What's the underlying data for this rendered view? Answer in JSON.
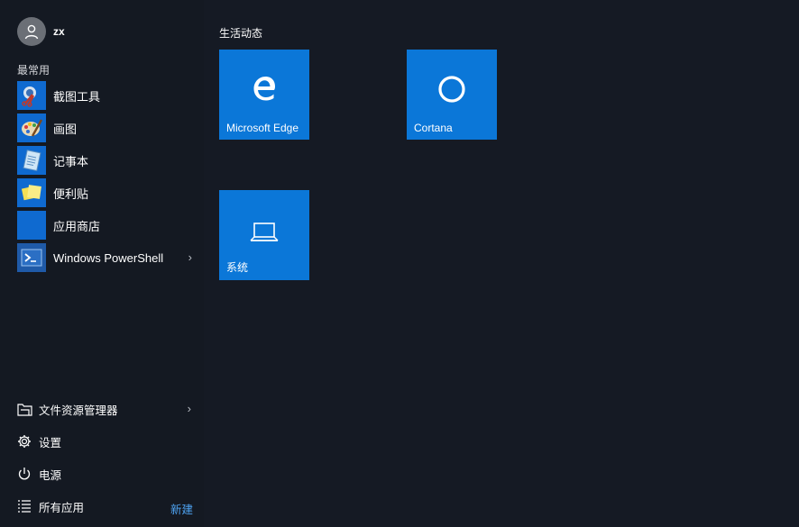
{
  "user": {
    "name": "zx"
  },
  "most_used": {
    "label": "最常用",
    "items": [
      {
        "label": "截图工具",
        "icon": "snipping-tool-icon",
        "has_submenu": false
      },
      {
        "label": "画图",
        "icon": "paint-icon",
        "has_submenu": false
      },
      {
        "label": "记事本",
        "icon": "notepad-icon",
        "has_submenu": false
      },
      {
        "label": "便利贴",
        "icon": "sticky-notes-icon",
        "has_submenu": false
      },
      {
        "label": "应用商店",
        "icon": "store-icon",
        "has_submenu": false
      },
      {
        "label": "Windows PowerShell",
        "icon": "powershell-icon",
        "has_submenu": true
      }
    ]
  },
  "bottom": {
    "file_explorer": "文件资源管理器",
    "settings": "设置",
    "power": "电源",
    "all_apps": "所有应用",
    "new_badge": "新建"
  },
  "tiles": {
    "group_title": "生活动态",
    "items": [
      {
        "label": "Microsoft Edge",
        "icon": "edge-icon"
      },
      {
        "label": "Cortana",
        "icon": "cortana-icon"
      },
      {
        "label": "系统",
        "icon": "laptop-icon"
      }
    ]
  },
  "colors": {
    "tile": "#0b77d8",
    "accent_link": "#4ea3f2",
    "background": "#151a24"
  }
}
